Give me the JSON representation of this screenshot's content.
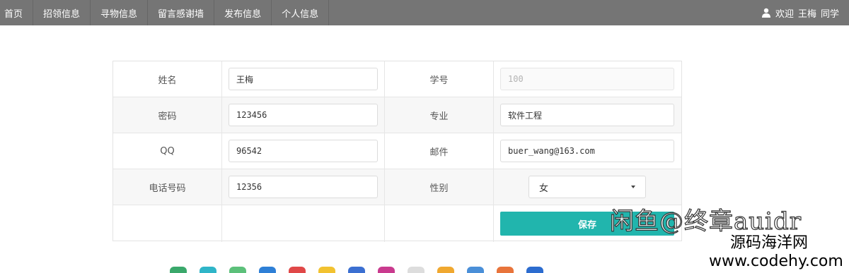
{
  "nav": {
    "items": [
      "首页",
      "招领信息",
      "寻物信息",
      "留言感谢墙",
      "发布信息",
      "个人信息"
    ],
    "welcome": "欢迎",
    "user_name": "王梅",
    "user_suffix": "同学"
  },
  "form": {
    "rows": [
      {
        "label1": "姓名",
        "value1": "王梅",
        "label2": "学号",
        "value2": "100"
      },
      {
        "label1": "密码",
        "value1": "123456",
        "label2": "专业",
        "value2": "软件工程"
      },
      {
        "label1": "QQ",
        "value1": "96542",
        "label2": "邮件",
        "value2": "buer_wang@163.com"
      },
      {
        "label1": "电话号码",
        "value1": "12356",
        "label2": "性别",
        "select_value": "女"
      }
    ],
    "save_label": "保存"
  },
  "watermark": {
    "line1": "闲鱼@终章auidr",
    "line2": "源码海洋网",
    "line3": "www.codehy.com"
  },
  "colors": {
    "navbar": "#757575",
    "save_button": "#21b5ad"
  }
}
